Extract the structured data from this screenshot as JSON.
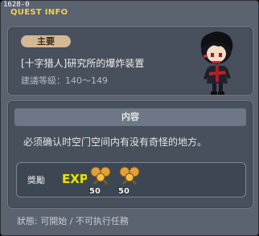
{
  "window": {
    "quest_id": "1628-0",
    "title": "QUEST INFO"
  },
  "quest": {
    "badge": "主要",
    "name": "[十字猎人]研究所的爆炸装置",
    "level_label": "建議等級：140～149"
  },
  "content": {
    "header": "内容",
    "description": "必须确认时空门空间内有没有奇怪的地方。"
  },
  "reward": {
    "label": "獎勵",
    "exp_text": "EXP",
    "items": [
      {
        "name": "coin-50",
        "count_text": "50"
      },
      {
        "name": "coin-50",
        "count_text": "50"
      }
    ]
  },
  "status": {
    "text": "狀態: 可開始 / 不可执行任務"
  },
  "colors": {
    "title": "#f2d24a",
    "badge": "#d4b894",
    "exp": "#f5d716"
  }
}
